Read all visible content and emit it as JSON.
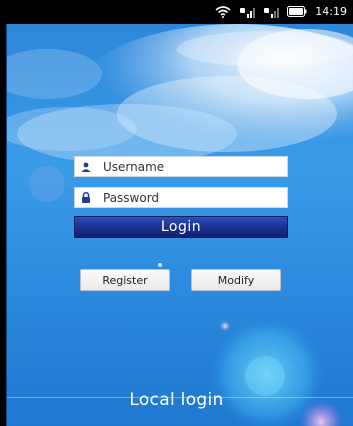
{
  "status_bar": {
    "time": "14:19",
    "icons": [
      "wifi-icon",
      "signal-icon",
      "signal-icon",
      "battery-icon"
    ]
  },
  "login": {
    "username_placeholder": "Username",
    "password_placeholder": "Password",
    "login_label": "Login",
    "register_label": "Register",
    "modify_label": "Modify",
    "local_login_label": "Local login"
  },
  "colors": {
    "sky": "#2f8de0",
    "login_button": "#1a2f8e"
  }
}
